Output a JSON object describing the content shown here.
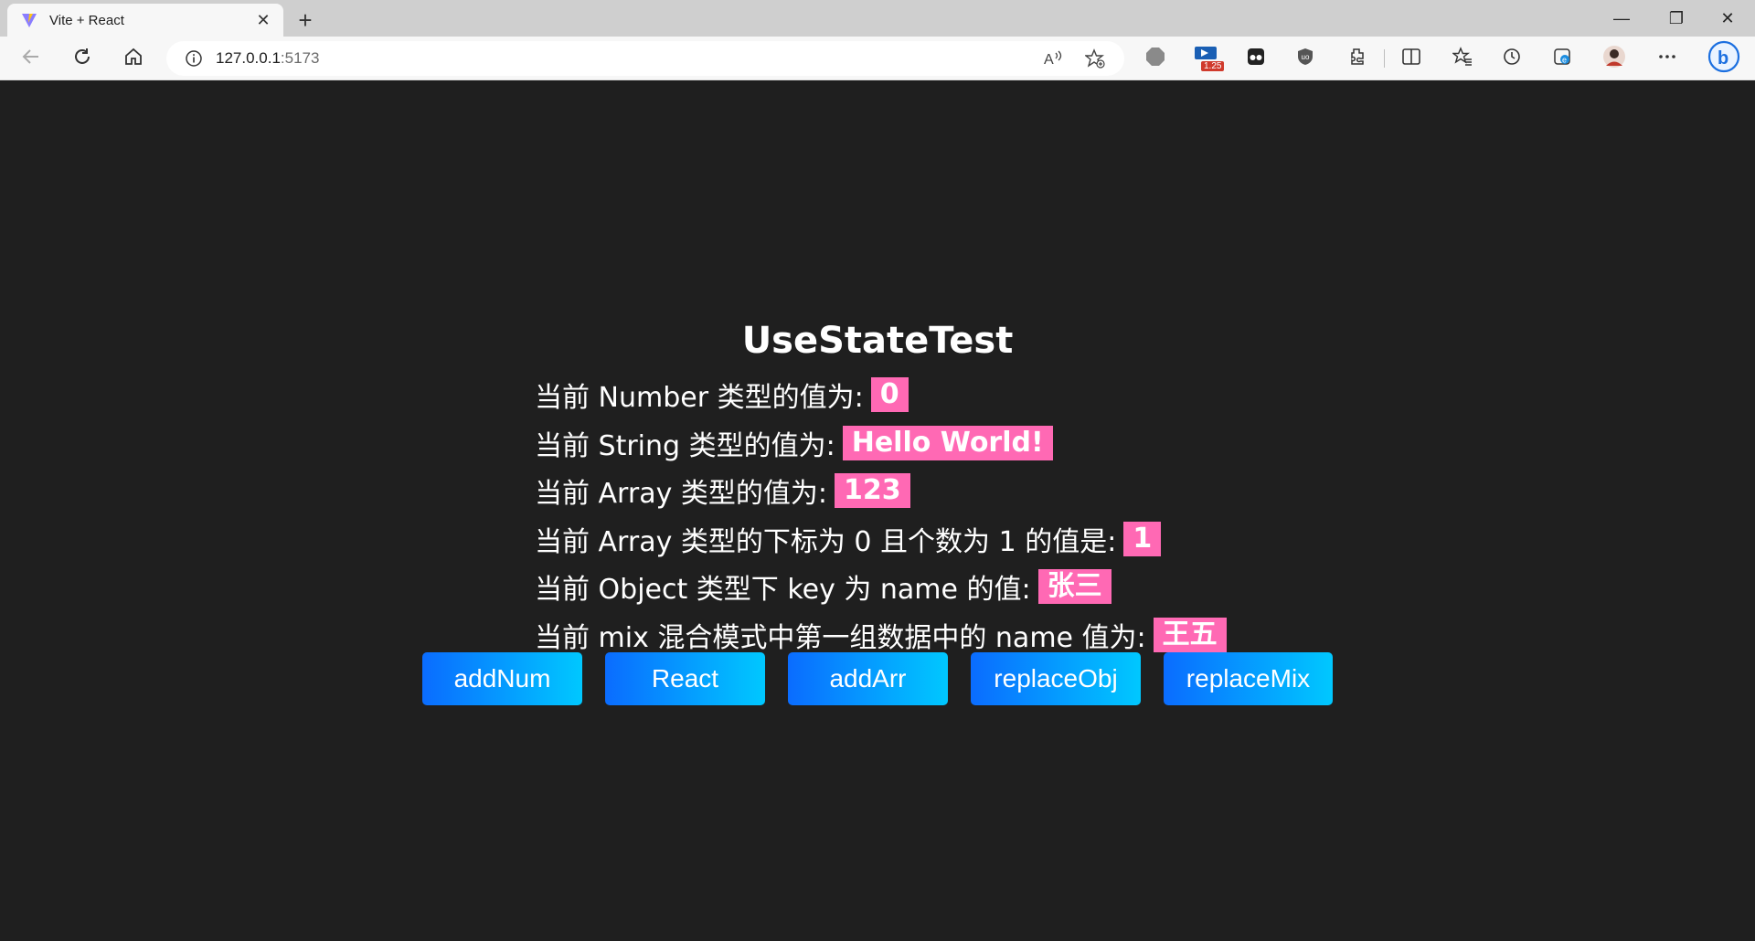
{
  "browser": {
    "tab": {
      "title": "Vite + React",
      "close": "✕"
    },
    "new_tab": "+",
    "address": {
      "host": "127.0.0.1",
      "port": ":5173"
    },
    "extension_badge": "1.25",
    "window_controls": {
      "minimize": "—",
      "restore": "❐",
      "close": "✕"
    }
  },
  "page": {
    "title": "UseStateTest",
    "lines": [
      {
        "label": "当前 Number 类型的值为:",
        "value": "0"
      },
      {
        "label": "当前 String 类型的值为:",
        "value": "Hello World!"
      },
      {
        "label": "当前 Array 类型的值为:",
        "value": "123"
      },
      {
        "label": "当前 Array 类型的下标为 0 且个数为 1 的值是:",
        "value": "1"
      },
      {
        "label": "当前 Object 类型下 key 为 name 的值:",
        "value": "张三"
      },
      {
        "label": "当前 mix 混合模式中第一组数据中的 name 值为:",
        "value": "王五"
      }
    ],
    "buttons": [
      "addNum",
      "React",
      "addArr",
      "replaceObj",
      "replaceMix"
    ]
  },
  "colors": {
    "page_background": "#1f1f1f",
    "value_highlight": "#ff69b4",
    "button_gradient_start": "#0a6cff",
    "button_gradient_end": "#00c8ff"
  },
  "icons": {
    "tab_favicon": "vite-logo-icon",
    "back": "back-arrow-icon",
    "refresh": "refresh-icon",
    "home": "home-icon",
    "info": "info-icon",
    "read_aloud": "read-aloud-icon",
    "favorite_add": "add-favorite-icon",
    "extensions": "extensions-icon",
    "split": "split-screen-icon",
    "favorites": "favorites-icon",
    "history": "history-icon",
    "collections": "collections-icon",
    "profile": "profile-avatar",
    "more": "more-icon",
    "bing": "bing-icon"
  }
}
